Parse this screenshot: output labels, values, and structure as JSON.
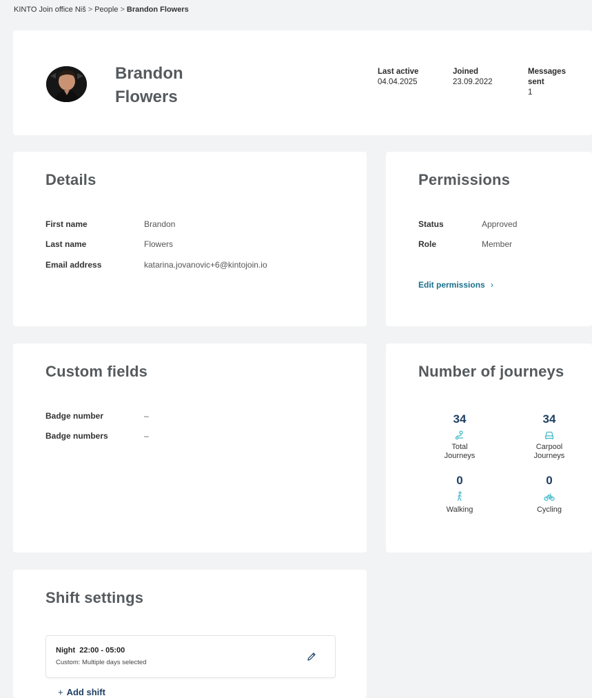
{
  "breadcrumb": {
    "items": [
      "KINTO Join office Niš",
      "People"
    ],
    "current": "Brandon Flowers",
    "separator": ">"
  },
  "profile": {
    "name": "Brandon Flowers",
    "stats": [
      {
        "label": "Last active",
        "value": "04.04.2025"
      },
      {
        "label": "Joined",
        "value": "23.09.2022"
      },
      {
        "label": "Messages sent",
        "value": "1"
      }
    ]
  },
  "details": {
    "title": "Details",
    "fields": [
      {
        "label": "First name",
        "value": "Brandon"
      },
      {
        "label": "Last name",
        "value": "Flowers"
      },
      {
        "label": "Email address",
        "value": "katarina.jovanovic+6@kintojoin.io"
      }
    ]
  },
  "permissions": {
    "title": "Permissions",
    "fields": [
      {
        "label": "Status",
        "value": "Approved"
      },
      {
        "label": "Role",
        "value": "Member"
      }
    ],
    "edit_label": "Edit permissions",
    "edit_chevron": "›"
  },
  "custom_fields": {
    "title": "Custom fields",
    "fields": [
      {
        "label": "Badge number",
        "value": "–"
      },
      {
        "label": "Badge numbers",
        "value": "–"
      }
    ]
  },
  "journeys": {
    "title": "Number of journeys",
    "items": [
      {
        "value": "34",
        "label": "Total Journeys",
        "icon": "route-icon"
      },
      {
        "value": "34",
        "label": "Carpool Journeys",
        "icon": "car-icon"
      },
      {
        "value": "0",
        "label": "Walking",
        "icon": "walking-icon"
      },
      {
        "value": "0",
        "label": "Cycling",
        "icon": "bicycle-icon"
      }
    ],
    "accent_color": "#3fb8c9",
    "number_color": "#1f3f63"
  },
  "shift_settings": {
    "title": "Shift settings",
    "shifts": [
      {
        "name": "Night",
        "time": "22:00 - 05:00",
        "description": "Custom: Multiple days selected"
      }
    ],
    "add_label": "Add shift"
  },
  "colors": {
    "background": "#f2f3f5",
    "card": "#ffffff",
    "title": "#555a5e",
    "link": "#1b6f8a"
  }
}
